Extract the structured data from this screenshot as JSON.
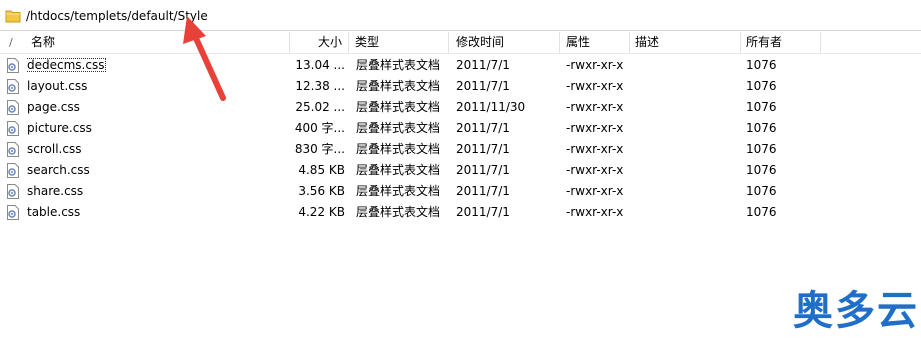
{
  "path_bar": {
    "folder_icon": "folder-icon",
    "path": "/htdocs/templets/default/Style"
  },
  "columns": {
    "sort_indicator": "/",
    "name": "名称",
    "size": "大小",
    "type": "类型",
    "modified": "修改时间",
    "permissions": "属性",
    "description": "描述",
    "owner": "所有者"
  },
  "files": [
    {
      "name": "dedecms.css",
      "size": "13.04 ...",
      "type": "层叠样式表文档",
      "modified": "2011/7/1",
      "permissions": "-rwxr-xr-x",
      "description": "",
      "owner": "1076",
      "icon": "css-file-icon"
    },
    {
      "name": "layout.css",
      "size": "12.38 ...",
      "type": "层叠样式表文档",
      "modified": "2011/7/1",
      "permissions": "-rwxr-xr-x",
      "description": "",
      "owner": "1076",
      "icon": "css-file-icon"
    },
    {
      "name": "page.css",
      "size": "25.02 ...",
      "type": "层叠样式表文档",
      "modified": "2011/11/30",
      "permissions": "-rwxr-xr-x",
      "description": "",
      "owner": "1076",
      "icon": "css-file-icon"
    },
    {
      "name": "picture.css",
      "size": "400 字...",
      "type": "层叠样式表文档",
      "modified": "2011/7/1",
      "permissions": "-rwxr-xr-x",
      "description": "",
      "owner": "1076",
      "icon": "css-file-icon"
    },
    {
      "name": "scroll.css",
      "size": "830 字...",
      "type": "层叠样式表文档",
      "modified": "2011/7/1",
      "permissions": "-rwxr-xr-x",
      "description": "",
      "owner": "1076",
      "icon": "css-file-icon"
    },
    {
      "name": "search.css",
      "size": "4.85 KB",
      "type": "层叠样式表文档",
      "modified": "2011/7/1",
      "permissions": "-rwxr-xr-x",
      "description": "",
      "owner": "1076",
      "icon": "css-file-icon"
    },
    {
      "name": "share.css",
      "size": "3.56 KB",
      "type": "层叠样式表文档",
      "modified": "2011/7/1",
      "permissions": "-rwxr-xr-x",
      "description": "",
      "owner": "1076",
      "icon": "css-file-icon"
    },
    {
      "name": "table.css",
      "size": "4.22 KB",
      "type": "层叠样式表文档",
      "modified": "2011/7/1",
      "permissions": "-rwxr-xr-x",
      "description": "",
      "owner": "1076",
      "icon": "css-file-icon"
    }
  ],
  "annotation": {
    "icon": "red-arrow-icon",
    "color": "#e8413a"
  },
  "watermark": {
    "text": "奥多云",
    "color": "#1f6fc8"
  },
  "colors": {
    "border": "#e2e2e2",
    "folder": "#e8b830"
  }
}
